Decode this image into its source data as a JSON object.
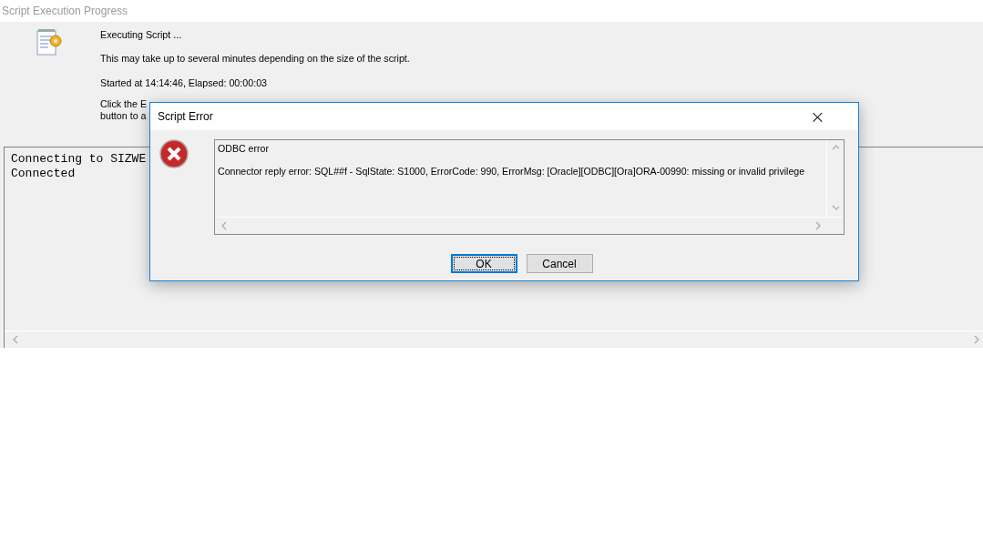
{
  "window": {
    "title": "Script Execution Progress"
  },
  "progress": {
    "heading": "Executing Script ...",
    "note": "This may take up to several minutes depending on the size of the script.",
    "timing": "Started at 14:14:46, Elapsed: 00:00:03",
    "instructions": [
      "Click the E",
      "button to a"
    ]
  },
  "log": {
    "lines": [
      "Connecting to SIZWE",
      "Connected"
    ]
  },
  "dialog": {
    "title": "Script Error",
    "close": "×",
    "message": [
      "ODBC error",
      "Connector reply error: SQL##f - SqlState: S1000, ErrorCode: 990, ErrorMsg: [Oracle][ODBC][Ora]ORA-00990: missing or invalid privilege"
    ],
    "buttons": [
      {
        "label": "OK",
        "kind": "default"
      },
      {
        "label": "Cancel",
        "kind": "normal"
      }
    ]
  }
}
